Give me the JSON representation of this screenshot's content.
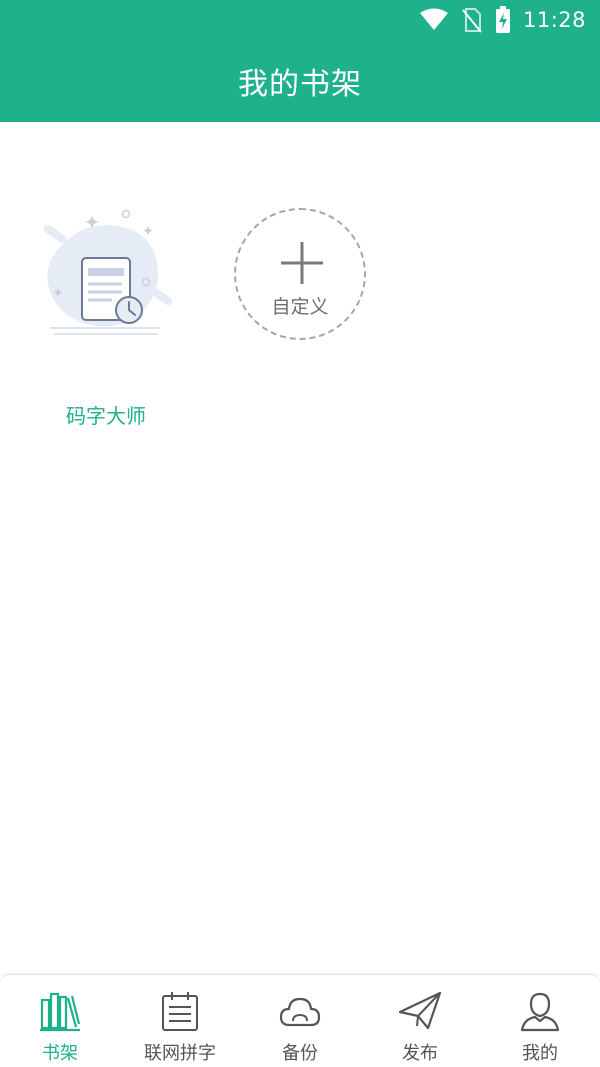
{
  "status_bar": {
    "time": "11:28",
    "icons": [
      "wifi-icon",
      "no-sim-icon",
      "battery-charging-icon"
    ]
  },
  "app_bar": {
    "title": "我的书架"
  },
  "shelf": {
    "books": [
      {
        "title": "码字大师",
        "cover_icon": "document-clock-icon"
      }
    ],
    "add_button": {
      "label": "自定义",
      "icon": "plus-icon"
    }
  },
  "bottom_nav": {
    "items": [
      {
        "label": "书架",
        "icon": "bookshelf-icon",
        "active": true
      },
      {
        "label": "联网拼字",
        "icon": "calendar-list-icon",
        "active": false
      },
      {
        "label": "备份",
        "icon": "cloud-icon",
        "active": false
      },
      {
        "label": "发布",
        "icon": "paper-plane-icon",
        "active": false
      },
      {
        "label": "我的",
        "icon": "person-icon",
        "active": false
      }
    ]
  },
  "colors": {
    "brand": "#1fb08c",
    "inactive": "#555555",
    "dashed_border": "#a6a6a6"
  }
}
